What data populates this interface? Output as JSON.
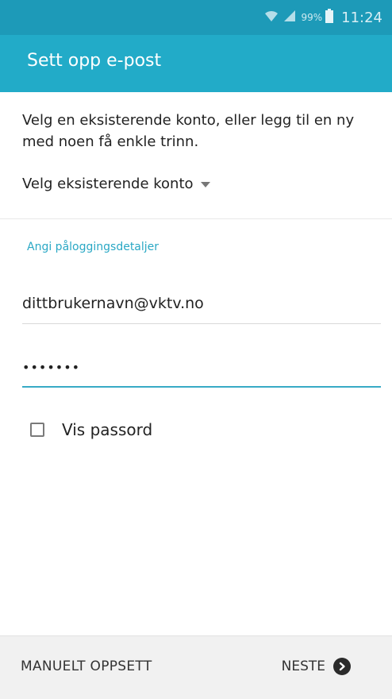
{
  "status_bar": {
    "battery_percent": "99%",
    "time": "11:24"
  },
  "app_bar": {
    "title": "Sett opp e-post"
  },
  "intro_text": "Velg en eksisterende konto, eller legg til en ny med noen få enkle trinn.",
  "account_select": {
    "label": "Velg eksisterende konto"
  },
  "login_section": {
    "label": "Angi påloggingsdetaljer",
    "email_value": "dittbrukernavn@vktv.no",
    "password_value": "•••••••"
  },
  "show_password": {
    "label": "Vis passord",
    "checked": false
  },
  "bottom_bar": {
    "manual_setup_label": "MANUELT OPPSETT",
    "next_label": "NESTE"
  },
  "colors": {
    "status_bar": "#1d9ab8",
    "app_bar": "#22abc8",
    "accent": "#2aa8c5"
  }
}
